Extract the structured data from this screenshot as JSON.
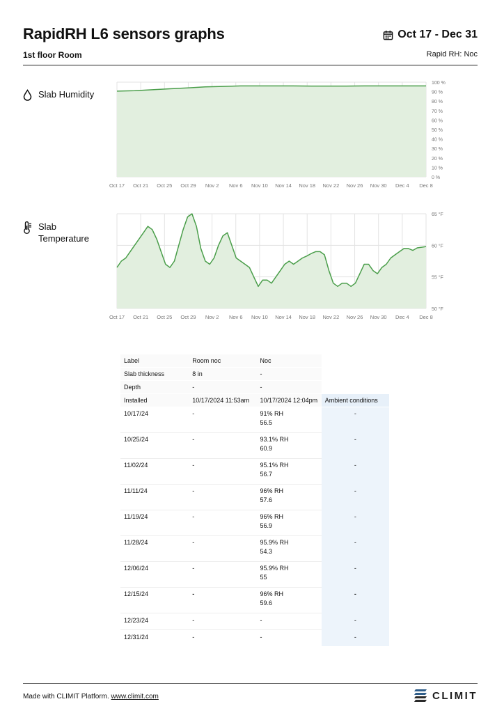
{
  "header": {
    "title": "RapidRH L6 sensors graphs",
    "date_range": "Oct 17 - Dec 31",
    "subtitle": "1st floor Room",
    "sensor_label": "Rapid RH: Noc"
  },
  "colors": {
    "line": "#4a9e4a",
    "fill": "#e2efdf",
    "grid": "#e3e3e3",
    "ambient": "#edf4fb"
  },
  "charts": {
    "humidity": {
      "label": "Slab Humidity",
      "icon": "droplet-icon"
    },
    "temperature": {
      "label_line1": "Slab",
      "label_line2": "Temperature",
      "icon": "thermometer-icon"
    }
  },
  "chart_data": [
    {
      "type": "area",
      "x": [
        "Oct 17",
        "Oct 21",
        "Oct 25",
        "Oct 29",
        "Nov 2",
        "Nov 6",
        "Nov 10",
        "Nov 14",
        "Nov 18",
        "Nov 22",
        "Nov 26",
        "Nov 30",
        "Dec 4",
        "Dec 8"
      ],
      "x_range": [
        0,
        70
      ],
      "points": [
        [
          0,
          90.5
        ],
        [
          4,
          91
        ],
        [
          8,
          92
        ],
        [
          12,
          93
        ],
        [
          16,
          94
        ],
        [
          20,
          95
        ],
        [
          24,
          95.5
        ],
        [
          28,
          96
        ],
        [
          32,
          96
        ],
        [
          36,
          96
        ],
        [
          40,
          96
        ],
        [
          44,
          95.9
        ],
        [
          48,
          95.9
        ],
        [
          52,
          95.9
        ],
        [
          56,
          96
        ],
        [
          60,
          96
        ],
        [
          64,
          96
        ],
        [
          68,
          96
        ],
        [
          70,
          96
        ]
      ],
      "yticks": [
        "0 %",
        "10 %",
        "20 %",
        "30 %",
        "40 %",
        "50 %",
        "60 %",
        "70 %",
        "80 %",
        "90 %",
        "100 %"
      ],
      "ylim": [
        0,
        100
      ]
    },
    {
      "type": "area",
      "x": [
        "Oct 17",
        "Oct 21",
        "Oct 25",
        "Oct 29",
        "Nov 2",
        "Nov 6",
        "Nov 10",
        "Nov 14",
        "Nov 18",
        "Nov 22",
        "Nov 26",
        "Nov 30",
        "Dec 4",
        "Dec 8"
      ],
      "x_range": [
        0,
        70
      ],
      "points": [
        [
          0,
          56.5
        ],
        [
          1,
          57.5
        ],
        [
          2,
          58
        ],
        [
          3,
          59
        ],
        [
          4,
          60
        ],
        [
          5,
          61
        ],
        [
          6,
          62
        ],
        [
          7,
          63
        ],
        [
          8,
          62.5
        ],
        [
          9,
          61
        ],
        [
          10,
          59
        ],
        [
          11,
          57
        ],
        [
          12,
          56.5
        ],
        [
          13,
          57.5
        ],
        [
          14,
          60
        ],
        [
          15,
          62.5
        ],
        [
          16,
          64.5
        ],
        [
          17,
          65
        ],
        [
          18,
          63
        ],
        [
          19,
          59.5
        ],
        [
          20,
          57.5
        ],
        [
          21,
          57
        ],
        [
          22,
          58
        ],
        [
          23,
          60
        ],
        [
          24,
          61.5
        ],
        [
          25,
          62
        ],
        [
          26,
          60
        ],
        [
          27,
          58
        ],
        [
          28,
          57.5
        ],
        [
          29,
          57
        ],
        [
          30,
          56.5
        ],
        [
          31,
          55
        ],
        [
          32,
          53.5
        ],
        [
          33,
          54.5
        ],
        [
          34,
          54.5
        ],
        [
          35,
          54
        ],
        [
          36,
          55
        ],
        [
          37,
          56
        ],
        [
          38,
          57
        ],
        [
          39,
          57.5
        ],
        [
          40,
          57
        ],
        [
          41,
          57.5
        ],
        [
          42,
          58
        ],
        [
          43,
          58.3
        ],
        [
          44,
          58.7
        ],
        [
          45,
          59
        ],
        [
          46,
          59
        ],
        [
          47,
          58.5
        ],
        [
          48,
          56
        ],
        [
          49,
          54
        ],
        [
          50,
          53.5
        ],
        [
          51,
          54
        ],
        [
          52,
          54
        ],
        [
          53,
          53.5
        ],
        [
          54,
          54
        ],
        [
          55,
          55.5
        ],
        [
          56,
          57
        ],
        [
          57,
          57
        ],
        [
          58,
          56
        ],
        [
          59,
          55.5
        ],
        [
          60,
          56.5
        ],
        [
          61,
          57
        ],
        [
          62,
          58
        ],
        [
          63,
          58.5
        ],
        [
          64,
          59
        ],
        [
          65,
          59.5
        ],
        [
          66,
          59.5
        ],
        [
          67,
          59.2
        ],
        [
          68,
          59.6
        ],
        [
          69,
          59.7
        ],
        [
          70,
          59.8
        ]
      ],
      "yticks": [
        "50 °F",
        "55 °F",
        "60 °F",
        "65 °F"
      ],
      "ylim": [
        50,
        65
      ]
    }
  ],
  "table": {
    "meta": [
      {
        "label": "Label",
        "room": "Room noc",
        "noc": "Noc",
        "amb": ""
      },
      {
        "label": "Slab thickness",
        "room": "8 in",
        "noc": "-",
        "amb": ""
      },
      {
        "label": "Depth",
        "room": "-",
        "noc": "-",
        "amb": ""
      },
      {
        "label": "Installed",
        "room": "10/17/2024 11:53am",
        "noc": "10/17/2024 12:04pm",
        "amb": "Ambient conditions"
      }
    ],
    "rows": [
      {
        "date": "10/17/24",
        "room": "-",
        "noc_rh": "91% RH",
        "noc_t": "56.5",
        "amb": "-"
      },
      {
        "date": "10/25/24",
        "room": "-",
        "noc_rh": "93.1% RH",
        "noc_t": "60.9",
        "amb": "-"
      },
      {
        "date": "11/02/24",
        "room": "-",
        "noc_rh": "95.1% RH",
        "noc_t": "56.7",
        "amb": "-"
      },
      {
        "date": "11/11/24",
        "room": "-",
        "noc_rh": "96% RH",
        "noc_t": "57.6",
        "amb": "-"
      },
      {
        "date": "11/19/24",
        "room": "-",
        "noc_rh": "96% RH",
        "noc_t": "56.9",
        "amb": "-"
      },
      {
        "date": "11/28/24",
        "room": "-",
        "noc_rh": "95.9% RH",
        "noc_t": "54.3",
        "amb": "-"
      },
      {
        "date": "12/06/24",
        "room": "-",
        "noc_rh": "95.9% RH",
        "noc_t": "55",
        "amb": "-"
      },
      {
        "date": "12/15/24",
        "room": "-",
        "noc_rh": "96% RH",
        "noc_t": "59.6",
        "amb": "-"
      },
      {
        "date": "12/23/24",
        "room": "-",
        "noc_rh": "-",
        "noc_t": "",
        "amb": "-"
      },
      {
        "date": "12/31/24",
        "room": "-",
        "noc_rh": "-",
        "noc_t": "",
        "amb": "-"
      }
    ]
  },
  "footer": {
    "made_with": "Made with CLIMIT Platform.",
    "link": "www.climit.com",
    "logo_text": "CLIMIT"
  }
}
